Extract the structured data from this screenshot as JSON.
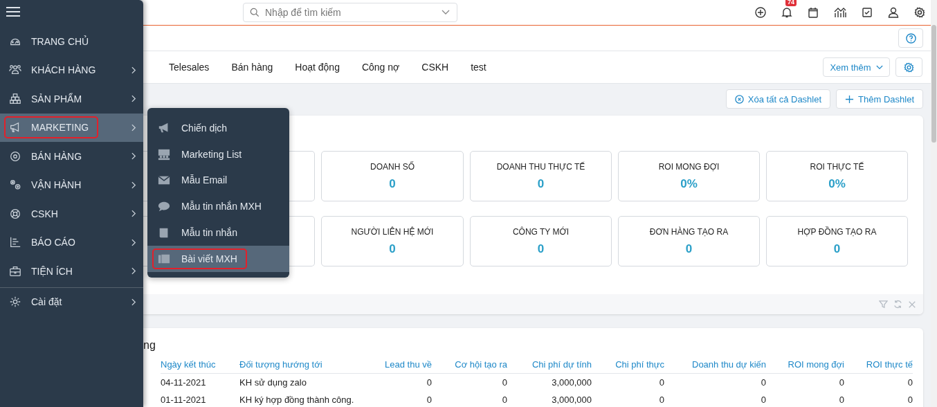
{
  "sidebar": {
    "items": [
      {
        "label": "TRANG CHỦ",
        "has_submenu": false,
        "selected": false
      },
      {
        "label": "KHÁCH HÀNG",
        "has_submenu": true,
        "selected": false
      },
      {
        "label": "SẢN PHẨM",
        "has_submenu": true,
        "selected": false
      },
      {
        "label": "MARKETING",
        "has_submenu": true,
        "selected": true
      },
      {
        "label": "BÁN HÀNG",
        "has_submenu": true,
        "selected": false
      },
      {
        "label": "VẬN HÀNH",
        "has_submenu": true,
        "selected": false
      },
      {
        "label": "CSKH",
        "has_submenu": true,
        "selected": false
      },
      {
        "label": "BÁO CÁO",
        "has_submenu": true,
        "selected": false
      },
      {
        "label": "TIỆN ÍCH",
        "has_submenu": true,
        "selected": false
      },
      {
        "label": "Cài đặt",
        "has_submenu": true,
        "selected": false
      }
    ]
  },
  "submenu": {
    "items": [
      {
        "label": "Chiến dịch",
        "selected": false
      },
      {
        "label": "Marketing List",
        "selected": false
      },
      {
        "label": "Mẫu Email",
        "selected": false
      },
      {
        "label": "Mẫu tin nhắn MXH",
        "selected": false
      },
      {
        "label": "Mẫu tin nhắn",
        "selected": false
      },
      {
        "label": "Bài viết MXH",
        "selected": true
      }
    ]
  },
  "search": {
    "placeholder": "Nhập để tìm kiếm"
  },
  "notification_count": "74",
  "tabs": [
    "Telesales",
    "Bán hàng",
    "Hoạt động",
    "Công nợ",
    "CSKH",
    "test"
  ],
  "more_button": "Xem thêm",
  "dashlet_actions": [
    "Xóa tất cả Dashlet",
    "Thêm Dashlet"
  ],
  "stats": [
    [
      {
        "label": "DOANH SỐ",
        "value": "0"
      },
      {
        "label": "DOANH THU THỰC TẾ",
        "value": "0"
      },
      {
        "label": "ROI MONG ĐỢI",
        "value": "0%"
      },
      {
        "label": "ROI THỰC TẾ",
        "value": "0%"
      }
    ],
    [
      {
        "label": "NGƯỜI LIÊN HỆ MỚI",
        "value": "0"
      },
      {
        "label": "CÔNG TY MỚI",
        "value": "0"
      },
      {
        "label": "ĐƠN HÀNG TẠO RA",
        "value": "0"
      },
      {
        "label": "HỢP ĐỒNG TẠO RA",
        "value": "0"
      }
    ]
  ],
  "table": {
    "title": "ng",
    "columns": [
      "Ngày kết thúc",
      "Đối tượng hướng tới",
      "Lead thu về",
      "Cơ hội tạo ra",
      "Chi phí dự tính",
      "Chi phí thực",
      "Doanh thu dự kiến",
      "ROI mong đợi",
      "ROI thực tế"
    ],
    "rows": [
      [
        "04-11-2021",
        "KH sử dụng zalo",
        "0",
        "0",
        "3,000,000",
        "0",
        "0",
        "0",
        "0"
      ],
      [
        "01-11-2021",
        "KH ký hợp đồng thành công.",
        "0",
        "0",
        "3,000,000",
        "0",
        "0",
        "0",
        "0"
      ]
    ]
  }
}
